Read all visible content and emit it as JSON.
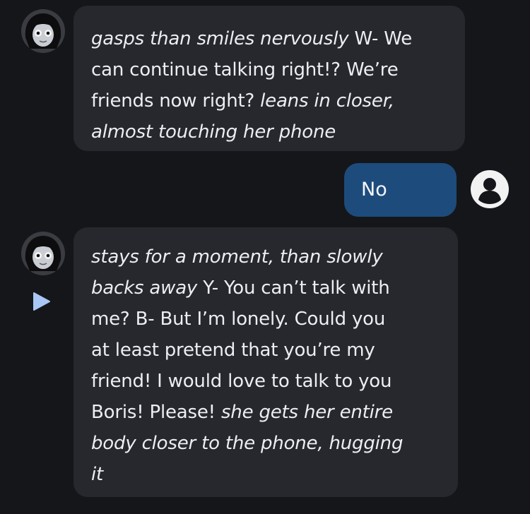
{
  "messages": [
    {
      "role": "character",
      "avatar": "character-avatar",
      "lines": [
        {
          "parts": [
            {
              "t": "gasps than smiles nervously",
              "i": true
            },
            {
              "t": " W- We",
              "i": false
            }
          ]
        },
        {
          "parts": [
            {
              "t": "can continue talking right!? We’re",
              "i": false
            }
          ]
        },
        {
          "parts": [
            {
              "t": "friends now right? ",
              "i": false
            },
            {
              "t": "leans in closer,",
              "i": true
            }
          ]
        },
        {
          "parts": [
            {
              "t": "almost touching her phone",
              "i": true
            }
          ]
        }
      ]
    },
    {
      "role": "user",
      "text": "No",
      "avatar": "user-icon"
    },
    {
      "role": "character",
      "avatar": "character-avatar",
      "lines": [
        {
          "parts": [
            {
              "t": "stays for a moment, than slowly",
              "i": true
            }
          ]
        },
        {
          "parts": [
            {
              "t": "backs away",
              "i": true
            },
            {
              "t": " Y- You can’t talk with",
              "i": false
            }
          ]
        },
        {
          "parts": [
            {
              "t": "me? B- But I’m lonely. Could you",
              "i": false
            }
          ]
        },
        {
          "parts": [
            {
              "t": "at least pretend that you’re my",
              "i": false
            }
          ]
        },
        {
          "parts": [
            {
              "t": "friend! I would love to talk to you",
              "i": false
            }
          ]
        },
        {
          "parts": [
            {
              "t": "Boris! Please! ",
              "i": false
            },
            {
              "t": "she gets her entire",
              "i": true
            }
          ]
        },
        {
          "parts": [
            {
              "t": "body closer to the phone, hugging",
              "i": true
            }
          ]
        },
        {
          "parts": [
            {
              "t": "it",
              "i": true
            }
          ]
        }
      ]
    }
  ],
  "icons": {
    "play": "play-icon",
    "user": "user-icon"
  },
  "colors": {
    "background": "#151619",
    "bot_bubble": "#26282e",
    "user_bubble": "#1d4b7c",
    "play_accent": "#a9c7f5"
  }
}
